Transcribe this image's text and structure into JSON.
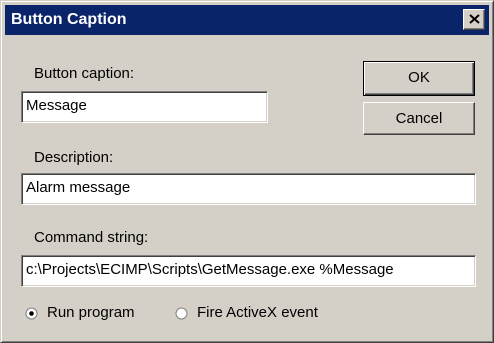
{
  "window": {
    "title": "Button Caption",
    "close_symbol": "×"
  },
  "form": {
    "caption_label": "Button caption:",
    "caption_value": "Message",
    "description_label": "Description:",
    "description_value": "Alarm message",
    "command_label": "Command string:",
    "command_value": "c:\\Projects\\ECIMP\\Scripts\\GetMessage.exe %Message"
  },
  "buttons": {
    "ok_label": "OK",
    "cancel_label": "Cancel"
  },
  "action_type": {
    "options": [
      {
        "label": "Run program",
        "selected": true
      },
      {
        "label": "Fire ActiveX event",
        "selected": false
      }
    ]
  },
  "icons": {
    "close": "close-icon",
    "radio_selected": "radio-selected-icon",
    "radio_unselected": "radio-unselected-icon"
  },
  "colors": {
    "title_bar": "#0a246a",
    "dialog_face": "#d4d0c8"
  }
}
